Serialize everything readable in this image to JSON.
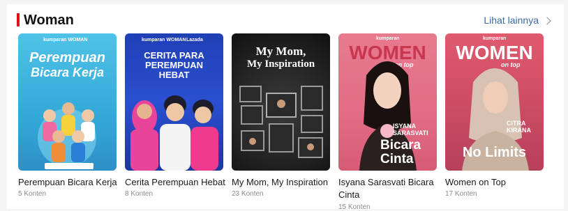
{
  "section": {
    "title": "Woman",
    "see_all": "Lihat lainnya"
  },
  "cards": [
    {
      "title": "Perempuan Bicara Kerja",
      "count": "5 Konten",
      "cover": {
        "brand": "kumparan WOMAN",
        "line1": "Perempuan",
        "line2": "Bicara Kerja"
      }
    },
    {
      "title": "Cerita Perempuan Hebat",
      "count": "8 Konten",
      "cover": {
        "brand": "kumparan WOMAN",
        "partner": "Lazada",
        "line1": "CERITA PARA",
        "line2": "PEREMPUAN",
        "line3": "HEBAT"
      }
    },
    {
      "title": "My Mom, My Inspiration",
      "count": "23 Konten",
      "cover": {
        "line1": "My Mom,",
        "line2": "My Inspiration"
      }
    },
    {
      "title": "Isyana Sarasvati Bicara Cinta",
      "count": "15 Konten",
      "cover": {
        "brand": "kumparan",
        "line1": "WOMEN",
        "tag": "on top",
        "name1": "ISYANA",
        "name2": "SARASVATI",
        "line2": "Bicara",
        "line3": "Cinta"
      }
    },
    {
      "title": "Women on Top",
      "count": "17 Konten",
      "cover": {
        "brand": "kumparan",
        "line1": "WOMEN",
        "tag": "on top",
        "name1": "CITRA",
        "name2": "KIRANA",
        "line2": "No Limits"
      }
    }
  ]
}
